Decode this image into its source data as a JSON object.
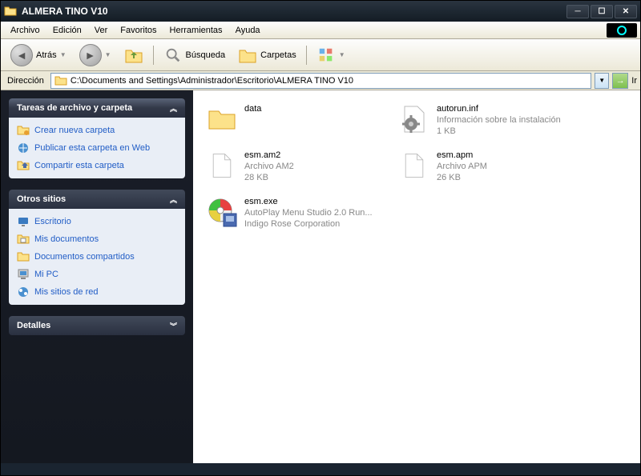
{
  "window": {
    "title": "ALMERA TINO V10"
  },
  "menu": {
    "items": [
      "Archivo",
      "Edición",
      "Ver",
      "Favoritos",
      "Herramientas",
      "Ayuda"
    ]
  },
  "toolbar": {
    "back": "Atrás",
    "search": "Búsqueda",
    "folders": "Carpetas"
  },
  "address": {
    "label": "Dirección",
    "path": "C:\\Documents and Settings\\Administrador\\Escritorio\\ALMERA TINO V10",
    "go": "Ir"
  },
  "sidebar": {
    "tasks": {
      "title": "Tareas de archivo y carpeta",
      "items": [
        {
          "label": "Crear nueva carpeta",
          "icon": "new-folder"
        },
        {
          "label": "Publicar esta carpeta en Web",
          "icon": "publish-web"
        },
        {
          "label": "Compartir esta carpeta",
          "icon": "share-folder"
        }
      ]
    },
    "places": {
      "title": "Otros sitios",
      "items": [
        {
          "label": "Escritorio",
          "icon": "desktop"
        },
        {
          "label": "Mis documentos",
          "icon": "my-documents"
        },
        {
          "label": "Documentos compartidos",
          "icon": "shared-docs"
        },
        {
          "label": "Mi PC",
          "icon": "my-computer"
        },
        {
          "label": "Mis sitios de red",
          "icon": "network"
        }
      ]
    },
    "details": {
      "title": "Detalles"
    }
  },
  "files": [
    {
      "name": "data",
      "line2": "",
      "line3": "",
      "icon": "folder"
    },
    {
      "name": "autorun.inf",
      "line2": "Información sobre la instalación",
      "line3": "1 KB",
      "icon": "gear-file"
    },
    {
      "name": "esm.am2",
      "line2": "Archivo AM2",
      "line3": "28 KB",
      "icon": "file"
    },
    {
      "name": "esm.apm",
      "line2": "Archivo APM",
      "line3": "26 KB",
      "icon": "file"
    },
    {
      "name": "esm.exe",
      "line2": "AutoPlay Menu Studio 2.0 Run...",
      "line3": "Indigo Rose Corporation",
      "icon": "cd-exe"
    }
  ]
}
